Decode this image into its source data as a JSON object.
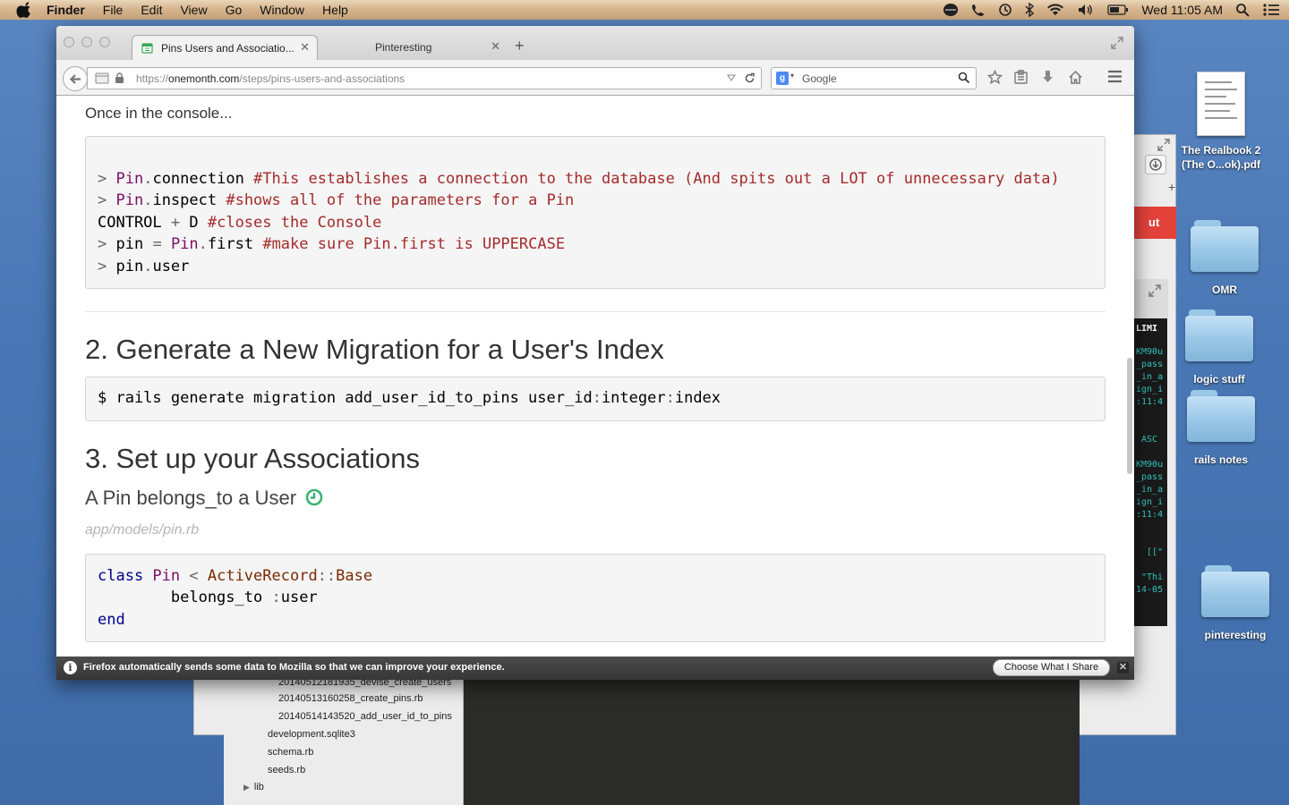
{
  "menubar": {
    "app_name": "Finder",
    "items": [
      "File",
      "Edit",
      "View",
      "Go",
      "Window",
      "Help"
    ],
    "clock": "Wed 11:05 AM",
    "status_icons": [
      "scout-icon",
      "phone-icon",
      "time-machine-icon",
      "bluetooth-icon",
      "wifi-icon",
      "volume-icon",
      "battery-icon",
      "spotlight-icon",
      "notification-center-icon"
    ]
  },
  "desktop": {
    "icons": [
      {
        "label_line1": "The Realbook 2",
        "label_line2": "(The O...ok).pdf",
        "kind": "pdf"
      },
      {
        "label": "OMR",
        "kind": "folder"
      },
      {
        "label": "logic stuff",
        "kind": "folder"
      },
      {
        "label": "rails notes",
        "kind": "folder"
      },
      {
        "label": "pinteresting",
        "kind": "folder"
      }
    ]
  },
  "background": {
    "red_button_label": "ut",
    "terminal_lines": [
      "LIMI",
      "KM90u",
      "_pass",
      "_in_a",
      "ign_i",
      ":11:4",
      "ASC",
      "KM90u",
      "_pass",
      "_in_a",
      "ign_i",
      ":11:4",
      "[[\"",
      "\"Thi",
      "14-05"
    ],
    "file_tree": [
      "20140512181935_devise_create_users",
      "20140513160258_create_pins.rb",
      "20140514143520_add_user_id_to_pins",
      "development.sqlite3",
      "schema.rb",
      "seeds.rb",
      "lib"
    ],
    "tree_arrow": "▶"
  },
  "browser": {
    "tabs": [
      {
        "title": "Pins Users and Associatio...",
        "active": true
      },
      {
        "title": "Pinteresting",
        "active": false
      }
    ],
    "close_glyph": "✕",
    "new_tab_glyph": "+",
    "url_scheme": "https://",
    "url_host": "onemonth.com",
    "url_path": "/steps/pins-users-and-associations",
    "search_engine_letter": "g",
    "search_placeholder": "Google",
    "notification": {
      "message": "Firefox automatically sends some data to Mozilla so that we can improve your experience.",
      "button": "Choose What I Share",
      "info_glyph": "i",
      "close_glyph": "✕"
    }
  },
  "page": {
    "intro": "Once in the console...",
    "console_block": [
      [
        {
          "t": "> ",
          "c": "gt"
        },
        {
          "t": "Pin",
          "c": "cls"
        },
        {
          "t": ".",
          "c": "op"
        },
        {
          "t": "connection ",
          "c": ""
        },
        {
          "t": "#This establishes a connection to the database (And spits out a LOT of unnecessary data)",
          "c": "cmt"
        }
      ],
      [
        {
          "t": "> ",
          "c": "gt"
        },
        {
          "t": "Pin",
          "c": "cls"
        },
        {
          "t": ".",
          "c": "op"
        },
        {
          "t": "inspect ",
          "c": ""
        },
        {
          "t": "#shows all of the parameters for a Pin",
          "c": "cmt"
        }
      ],
      [
        {
          "t": "CONTROL ",
          "c": ""
        },
        {
          "t": "+",
          "c": "op"
        },
        {
          "t": " D ",
          "c": ""
        },
        {
          "t": "#closes the Console",
          "c": "cmt"
        }
      ],
      [
        {
          "t": "> ",
          "c": "gt"
        },
        {
          "t": "pin ",
          "c": ""
        },
        {
          "t": "=",
          "c": "op"
        },
        {
          "t": " ",
          "c": ""
        },
        {
          "t": "Pin",
          "c": "cls"
        },
        {
          "t": ".",
          "c": "op"
        },
        {
          "t": "first ",
          "c": ""
        },
        {
          "t": "#make sure Pin.first is UPPERCASE",
          "c": "cmt"
        }
      ],
      [
        {
          "t": "> ",
          "c": "gt"
        },
        {
          "t": "pin",
          "c": ""
        },
        {
          "t": ".",
          "c": "op"
        },
        {
          "t": "user",
          "c": ""
        }
      ]
    ],
    "section2_title": "2. Generate a New Migration for a User's Index",
    "migration_block": [
      [
        {
          "t": "$ rails generate migration add_user_id_to_pins user_id",
          "c": ""
        },
        {
          "t": ":",
          "c": "op"
        },
        {
          "t": "integer",
          "c": ""
        },
        {
          "t": ":",
          "c": "op"
        },
        {
          "t": "index",
          "c": ""
        }
      ]
    ],
    "section3_title": "3. Set up your Associations",
    "subsection_title": "A Pin belongs_to a User",
    "file_path": "app/models/pin.rb",
    "model_block": [
      [
        {
          "t": "class ",
          "c": "kw"
        },
        {
          "t": "Pin",
          "c": "cls"
        },
        {
          "t": " < ",
          "c": "op"
        },
        {
          "t": "ActiveRecord",
          "c": "brown"
        },
        {
          "t": "::",
          "c": "op"
        },
        {
          "t": "Base",
          "c": "brown"
        }
      ],
      [
        {
          "t": "        belongs_to ",
          "c": ""
        },
        {
          "t": ":",
          "c": "op"
        },
        {
          "t": "user",
          "c": ""
        }
      ],
      [
        {
          "t": "end",
          "c": "kw"
        }
      ]
    ]
  },
  "colors": {
    "comment": "#a52a2a",
    "class_name": "#7a0f66",
    "keyword": "#00008b",
    "clock_icon": "#3cb371",
    "notification_bg": "#3c3c3c"
  }
}
